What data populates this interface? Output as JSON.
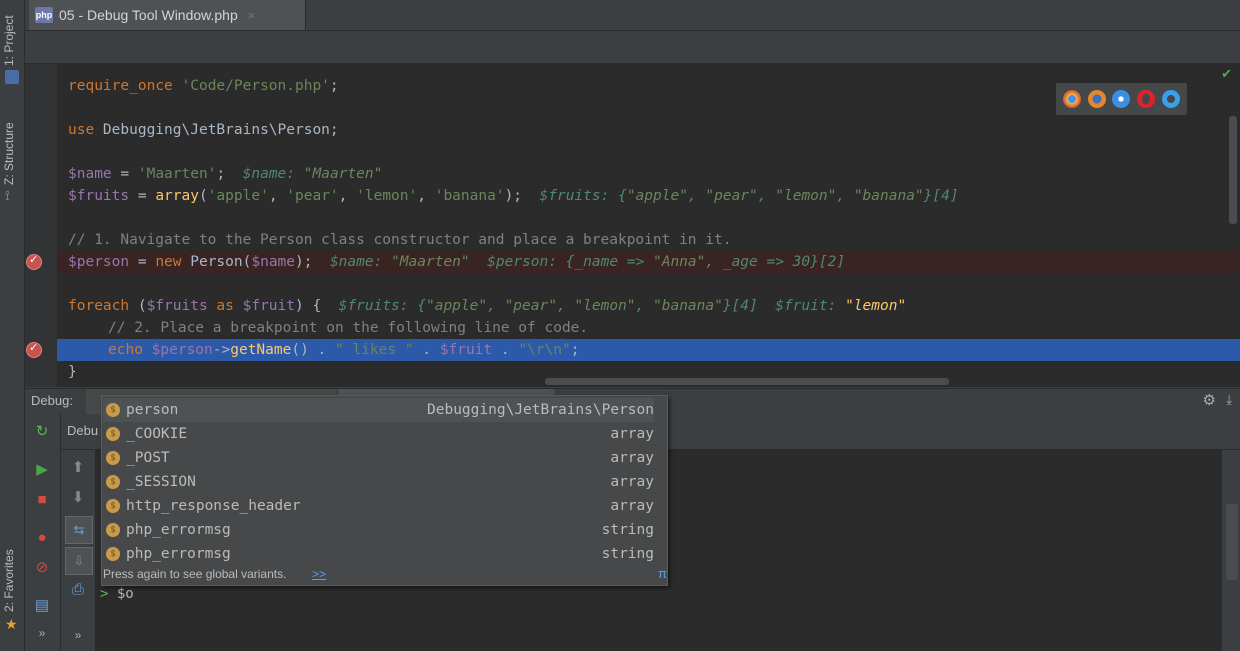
{
  "side_tabs": {
    "project": "1: Project",
    "structure": "Z: Structure",
    "favorites": "2: Favorites"
  },
  "file_tab": {
    "icon_label": "php",
    "label": "05 - Debug Tool Window.php",
    "close": "×"
  },
  "code": {
    "l1_kw": "require_once",
    "l1_str": "'Code/Person.php'",
    "l1_end": ";",
    "l2_kw": "use",
    "l2_rest": " Debugging\\JetBrains\\Person;",
    "l3_var": "$name",
    "l3_eq": " = ",
    "l3_str": "'Maarten'",
    "l3_end": ";",
    "l3_inl": "$name: ",
    "l3_inlv": "\"Maarten\"",
    "l4_var": "$fruits",
    "l4_eq": " = ",
    "l4_fn": "array",
    "l4_args_open": "(",
    "l4_s1": "'apple'",
    "l4_c1": ", ",
    "l4_s2": "'pear'",
    "l4_c2": ", ",
    "l4_s3": "'lemon'",
    "l4_c3": ", ",
    "l4_s4": "'banana'",
    "l4_end": ");",
    "l4_inl": "$fruits: {",
    "l4_iv1": "\"apple\"",
    "l4_ic1": ", ",
    "l4_iv2": "\"pear\"",
    "l4_ic2": ", ",
    "l4_iv3": "\"lemon\"",
    "l4_ic3": ", ",
    "l4_iv4": "\"banana\"",
    "l4_iend": "}[4]",
    "l5_cmt": "// 1. Navigate to the Person class constructor and place a breakpoint in it.",
    "l6_var": "$person",
    "l6_eq": " = ",
    "l6_kw": "new",
    "l6_cls": " Person(",
    "l6_arg": "$name",
    "l6_end": ");",
    "l6_inl1": "$name: ",
    "l6_inlv1": "\"Maarten\"",
    "l6_inl2": "$person: {_name => ",
    "l6_inlv2": "\"Anna\"",
    "l6_inl3": ", _age => 30}[2]",
    "l7_kw": "foreach",
    "l7_open": " (",
    "l7_var1": "$fruits",
    "l7_as": " as ",
    "l7_var2": "$fruit",
    "l7_end": ") {",
    "l7_inl1": "$fruits: {",
    "l7_iv1": "\"apple\"",
    "l7_ic1": ", ",
    "l7_iv2": "\"pear\"",
    "l7_ic2": ", ",
    "l7_iv3": "\"lemon\"",
    "l7_ic3": ", ",
    "l7_iv4": "\"banana\"",
    "l7_iend": "}[4]",
    "l7_inl2": "$fruit: ",
    "l7_inlv2": "\"lemon\"",
    "l8_cmt": "// 2. Place a breakpoint on the following line of code.",
    "l9_kw": "echo",
    "l9_var": " $person",
    "l9_arrow": "->",
    "l9_fn": "getName",
    "l9_rest1": "() . ",
    "l9_s1": "\" likes \"",
    "l9_rest2": " . ",
    "l9_var2": "$fruit",
    "l9_rest3": " . ",
    "l9_s2": "\"\\r\\n\"",
    "l9_end": ";",
    "l10": "}"
  },
  "debug": {
    "label": "Debug:",
    "sub_label": "Debu"
  },
  "autocomplete": {
    "items": [
      {
        "name": "person",
        "type": "Debugging\\JetBrains\\Person"
      },
      {
        "name": "_COOKIE",
        "type": "array"
      },
      {
        "name": "_POST",
        "type": "array"
      },
      {
        "name": "_SESSION",
        "type": "array"
      },
      {
        "name": "http_response_header",
        "type": "array"
      },
      {
        "name": "php_errormsg",
        "type": "string"
      },
      {
        "name": "php_errormsg",
        "type": "string"
      }
    ],
    "hint": "Press again to see global variants.",
    "link": ">>",
    "pi": "π"
  },
  "console": {
    "prompt_arrow": ">",
    "input": "$o"
  },
  "colors": {
    "keyword": "#cc7832",
    "string": "#6a8759",
    "variable": "#9876aa",
    "selected_line": "#2d5aa8",
    "breakpoint_line": "#3a2323"
  }
}
